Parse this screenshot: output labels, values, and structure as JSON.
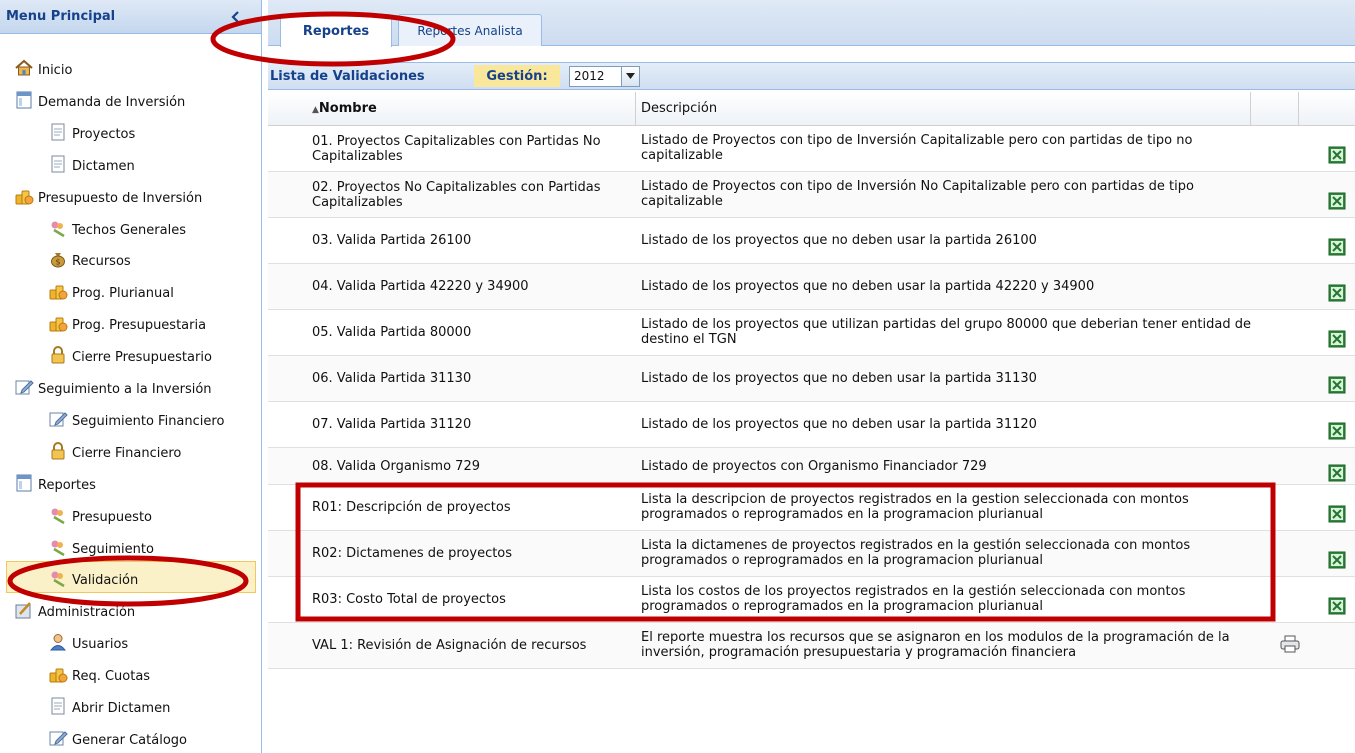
{
  "sidebar": {
    "title": "Menu Principal",
    "items": [
      {
        "label": "Inicio",
        "icon": "home-icon"
      },
      {
        "label": "Demanda de Inversión",
        "icon": "window-icon"
      },
      {
        "label": "Proyectos",
        "icon": "document-icon"
      },
      {
        "label": "Dictamen",
        "icon": "document-icon"
      },
      {
        "label": "Presupuesto de Inversión",
        "icon": "coins-stack-icon"
      },
      {
        "label": "Techos Generales",
        "icon": "flower-icon"
      },
      {
        "label": "Recursos",
        "icon": "money-bag-icon"
      },
      {
        "label": "Prog. Plurianual",
        "icon": "coins-stack-icon"
      },
      {
        "label": "Prog. Presupuestaria",
        "icon": "coins-stack-icon"
      },
      {
        "label": "Cierre Presupuestario",
        "icon": "padlock-icon"
      },
      {
        "label": "Seguimiento a la Inversión",
        "icon": "edit-icon"
      },
      {
        "label": "Seguimiento Financiero",
        "icon": "edit-icon"
      },
      {
        "label": "Cierre Financiero",
        "icon": "padlock-icon"
      },
      {
        "label": "Reportes",
        "icon": "window-icon"
      },
      {
        "label": "Presupuesto",
        "icon": "flower-icon"
      },
      {
        "label": "Seguimiento",
        "icon": "flower-icon"
      },
      {
        "label": "Validación",
        "icon": "flower-icon"
      },
      {
        "label": "Administración",
        "icon": "tools-icon"
      },
      {
        "label": "Usuarios",
        "icon": "user-icon"
      },
      {
        "label": "Req. Cuotas",
        "icon": "coins-stack-icon"
      },
      {
        "label": "Abrir Dictamen",
        "icon": "document-icon"
      },
      {
        "label": "Generar Catálogo",
        "icon": "edit-icon"
      }
    ]
  },
  "tabs": [
    {
      "label": "Reportes",
      "active": true
    },
    {
      "label": "Reportes Analista",
      "active": false
    }
  ],
  "toolbar": {
    "title": "Lista de Validaciones",
    "gestion_label": "Gestión:",
    "gestion_value": "2012"
  },
  "grid": {
    "columns": {
      "nombre": "Nombre",
      "descripcion": "Descripción"
    },
    "sort": "ascending",
    "rows": [
      {
        "nombre": "01. Proyectos Capitalizables con Partidas No Capitalizables",
        "descripcion": "Listado de Proyectos con tipo de Inversión Capitalizable pero con partidas de tipo no capitalizable",
        "action_icon": "excel-icon"
      },
      {
        "nombre": "02. Proyectos No Capitalizables con Partidas Capitalizables",
        "descripcion": "Listado de Proyectos con tipo de Inversión No Capitalizable pero con partidas de tipo capitalizable",
        "action_icon": "excel-icon"
      },
      {
        "nombre": "03. Valida Partida 26100",
        "descripcion": "Listado de los proyectos que no deben usar la partida 26100",
        "action_icon": "excel-icon"
      },
      {
        "nombre": "04. Valida Partida 42220 y 34900",
        "descripcion": "Listado de los proyectos que no deben usar la partida 42220 y 34900",
        "action_icon": "excel-icon"
      },
      {
        "nombre": "05. Valida Partida 80000",
        "descripcion": "Listado de los proyectos que utilizan partidas del grupo 80000 que deberian tener entidad de destino el TGN",
        "action_icon": "excel-icon"
      },
      {
        "nombre": "06. Valida Partida 31130",
        "descripcion": "Listado de los proyectos que no deben usar la partida 31130",
        "action_icon": "excel-icon"
      },
      {
        "nombre": "07. Valida Partida 31120",
        "descripcion": "Listado de los proyectos que no deben usar la partida 31120",
        "action_icon": "excel-icon"
      },
      {
        "nombre": "08. Valida Organismo 729",
        "descripcion": "Listado de proyectos con Organismo Financiador 729",
        "action_icon": "excel-icon"
      },
      {
        "nombre": "R01: Descripción de proyectos",
        "descripcion": "Lista la descripcion de proyectos registrados en la gestion seleccionada con montos programados o reprogramados en la programacion plurianual",
        "action_icon": "excel-icon"
      },
      {
        "nombre": "R02: Dictamenes de proyectos",
        "descripcion": "Lista la dictamenes de proyectos registrados en la gestión seleccionada con montos programados o reprogramados en la programacion plurianual",
        "action_icon": "excel-icon"
      },
      {
        "nombre": "R03: Costo Total de proyectos",
        "descripcion": "Lista los costos de los proyectos registrados en la gestión seleccionada con montos programados o reprogramados en la programacion plurianual",
        "action_icon": "excel-icon"
      },
      {
        "nombre": "VAL 1: Revisión de Asignación de recursos",
        "descripcion": "El reporte muestra los recursos que se asignaron en los modulos de la programación de la inversión, programación presupuestaria y programación financiera",
        "action_icon": "printer-icon"
      }
    ]
  },
  "colors": {
    "header_text": "#15428b",
    "panel_border": "#99bbe8",
    "gestion_bg": "#f9e79b",
    "selected_bg": "#fbf1c9",
    "annotation_red": "#c00000"
  }
}
